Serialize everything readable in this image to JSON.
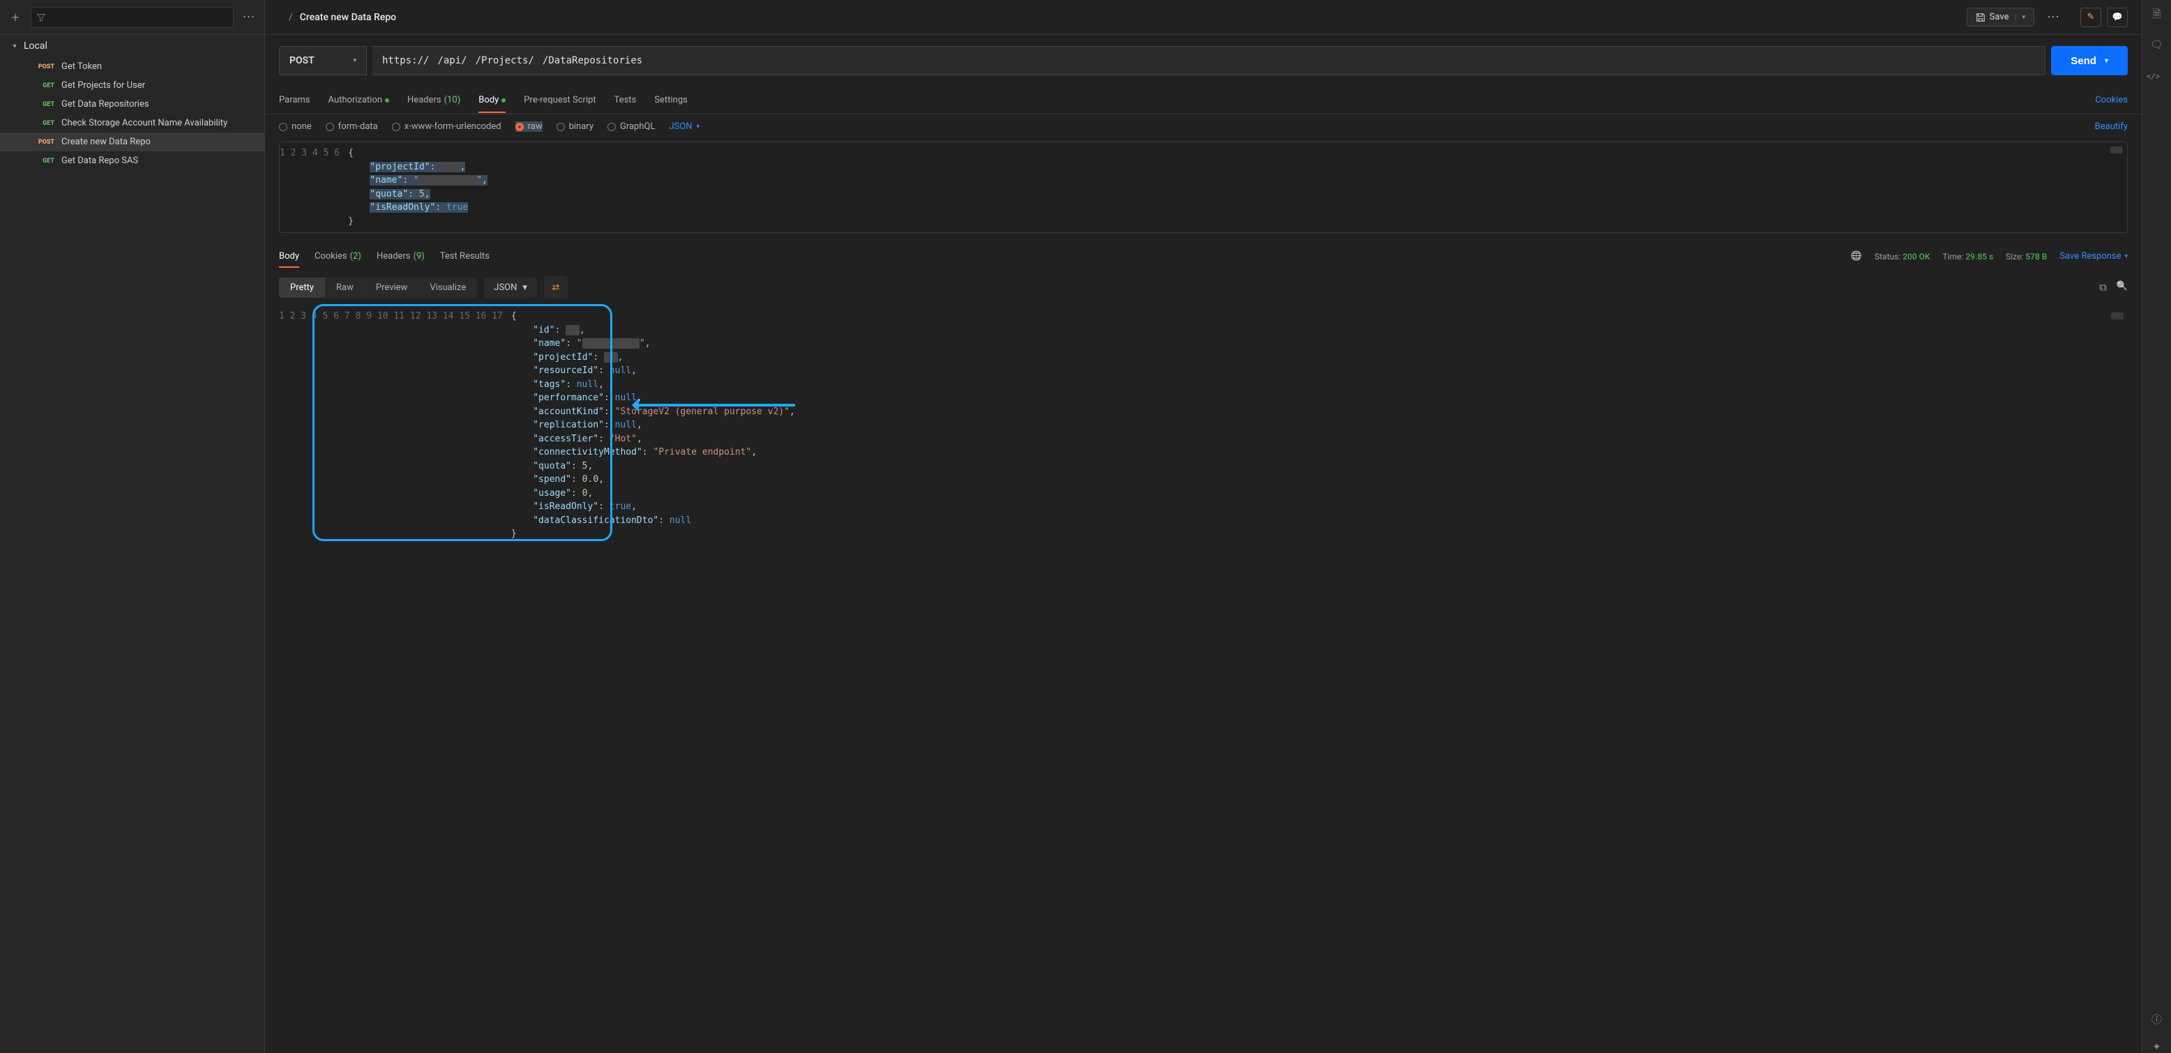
{
  "sidebar": {
    "collection": "Local",
    "items": [
      {
        "method": "POST",
        "name": "Get Token"
      },
      {
        "method": "GET",
        "name": "Get Projects for User"
      },
      {
        "method": "GET",
        "name": "Get Data Repositories"
      },
      {
        "method": "GET",
        "name": "Check Storage Account Name Availability"
      },
      {
        "method": "POST",
        "name": "Create new Data Repo"
      },
      {
        "method": "GET",
        "name": "Get Data Repo SAS"
      }
    ],
    "active_index": 4
  },
  "breadcrumb": {
    "sep": "/",
    "parent_redacted": "  ",
    "title": "Create new Data Repo"
  },
  "toolbar": {
    "save_label": "Save"
  },
  "request": {
    "method": "POST",
    "url_parts": {
      "scheme": "https://",
      "host_redacted": "                        ",
      "p1": "/api/",
      "r1": " ",
      "p2": "/Projects/",
      "r2": " ",
      "p3": "/DataRepositories"
    },
    "send_label": "Send"
  },
  "tabs": {
    "params": "Params",
    "auth": "Authorization",
    "headers": "Headers",
    "headers_count": "(10)",
    "body": "Body",
    "prereq": "Pre-request Script",
    "tests": "Tests",
    "settings": "Settings",
    "cookies": "Cookies"
  },
  "bodytypes": {
    "none": "none",
    "formdata": "form-data",
    "xwww": "x-www-form-urlencoded",
    "raw": "raw",
    "binary": "binary",
    "graphql": "GraphQL",
    "lang": "JSON",
    "beautify": "Beautify"
  },
  "request_body": [
    {
      "line": 1,
      "t": "{"
    },
    {
      "line": 2,
      "key": "projectId",
      "valRedacted": "   ",
      "trail": ","
    },
    {
      "line": 3,
      "key": "name",
      "strRedacted": "          ",
      "trail": ","
    },
    {
      "line": 4,
      "key": "quota",
      "num": "5",
      "trail": ","
    },
    {
      "line": 5,
      "key": "isReadOnly",
      "bool": "true"
    },
    {
      "line": 6,
      "t": "}"
    }
  ],
  "response_tabs": {
    "body": "Body",
    "cookies": "Cookies",
    "cookies_count": "(2)",
    "headers": "Headers",
    "headers_count": "(9)",
    "testresults": "Test Results"
  },
  "response_status": {
    "status_label": "Status:",
    "status_value": "200 OK",
    "time_label": "Time:",
    "time_value": "29.85 s",
    "size_label": "Size:",
    "size_value": "578 B",
    "save_response": "Save Response"
  },
  "view": {
    "pretty": "Pretty",
    "raw": "Raw",
    "preview": "Preview",
    "visualize": "Visualize",
    "lang": "JSON"
  },
  "response_body": [
    {
      "line": 1,
      "t": "{"
    },
    {
      "line": 2,
      "key": "id",
      "valRedacted": "  ",
      "trail": ","
    },
    {
      "line": 3,
      "key": "name",
      "strRedacted": "          ",
      "trail": ","
    },
    {
      "line": 4,
      "key": "projectId",
      "valRedacted": "  ",
      "trail": ","
    },
    {
      "line": 5,
      "key": "resourceId",
      "null": "null",
      "trail": ","
    },
    {
      "line": 6,
      "key": "tags",
      "null": "null",
      "trail": ","
    },
    {
      "line": 7,
      "key": "performance",
      "null": "null",
      "trail": ","
    },
    {
      "line": 8,
      "key": "accountKind",
      "str": "StorageV2 (general purpose v2)",
      "trail": ","
    },
    {
      "line": 9,
      "key": "replication",
      "null": "null",
      "trail": ","
    },
    {
      "line": 10,
      "key": "accessTier",
      "str": "Hot",
      "trail": ","
    },
    {
      "line": 11,
      "key": "connectivityMethod",
      "str": "Private endpoint",
      "trail": ","
    },
    {
      "line": 12,
      "key": "quota",
      "num": "5",
      "trail": ","
    },
    {
      "line": 13,
      "key": "spend",
      "num": "0.0",
      "trail": ","
    },
    {
      "line": 14,
      "key": "usage",
      "num": "0",
      "trail": ","
    },
    {
      "line": 15,
      "key": "isReadOnly",
      "bool": "true",
      "trail": ","
    },
    {
      "line": 16,
      "key": "dataClassificationDto",
      "null": "null"
    },
    {
      "line": 17,
      "t": "}"
    }
  ]
}
